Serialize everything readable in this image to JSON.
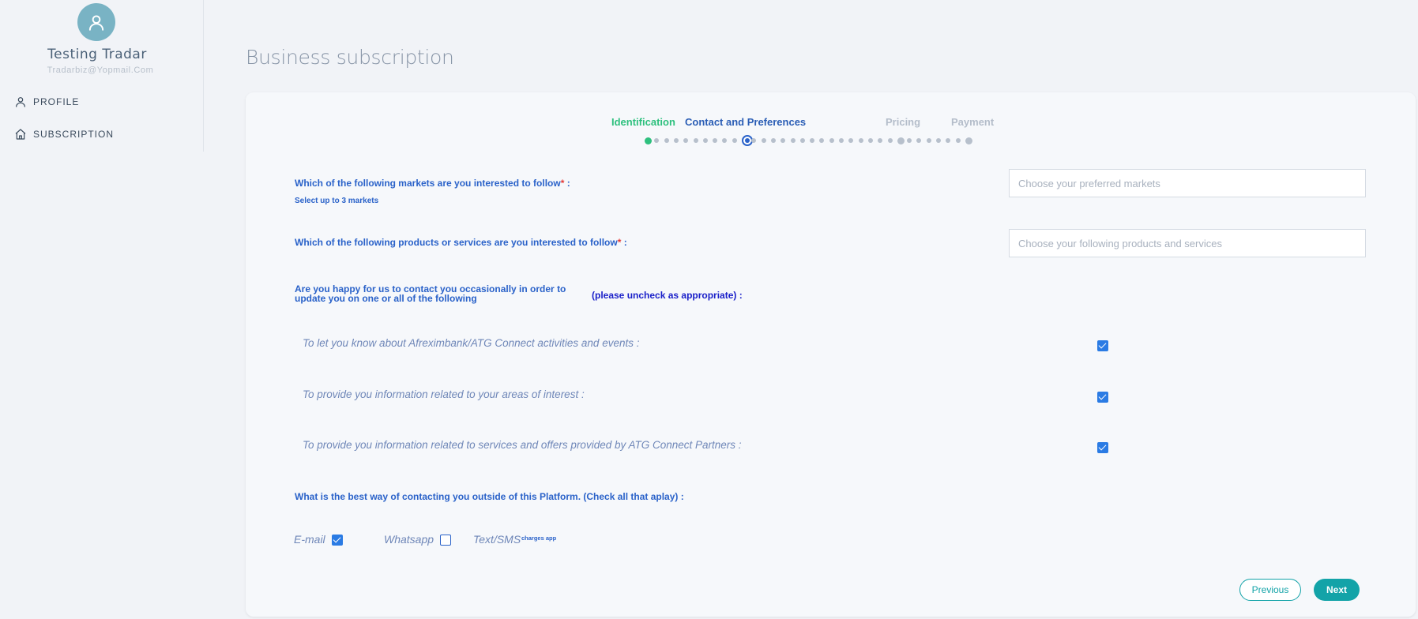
{
  "user": {
    "name": "Testing Tradar",
    "email": "Tradarbiz@Yopmail.Com"
  },
  "sidebar": {
    "items": [
      {
        "label": "PROFILE",
        "icon": "user-icon"
      },
      {
        "label": "SUBSCRIPTION",
        "icon": "home-icon"
      }
    ]
  },
  "page": {
    "title": "Business subscription"
  },
  "stepper": {
    "steps": [
      {
        "label": "Identification",
        "state": "done"
      },
      {
        "label": "Contact and Preferences",
        "state": "current"
      },
      {
        "label": "Pricing",
        "state": "upcoming"
      },
      {
        "label": "Payment",
        "state": "upcoming"
      }
    ]
  },
  "form": {
    "markets": {
      "question": "Which of the following markets are you interested to follow",
      "required_mark": "*",
      "suffix": " :",
      "hint": "Select up to 3 markets",
      "placeholder": "Choose your preferred markets"
    },
    "products": {
      "question": "Which of the following products or services are you interested to follow",
      "required_mark": "*",
      "suffix": " :",
      "placeholder": "Choose your following products and services"
    },
    "contact": {
      "question": "Are you happy for us to contact you occasionally in order to update you on one or all of the following",
      "note": "(please uncheck as appropriate) :",
      "options": [
        {
          "label": "To let you know about Afreximbank/ATG Connect activities and events :",
          "checked": true
        },
        {
          "label": "To provide you information related to your areas of interest :",
          "checked": true
        },
        {
          "label": "To provide you information related to services and offers provided by ATG Connect Partners :",
          "checked": true
        }
      ]
    },
    "channels": {
      "question": "What is the best way of contacting you outside of this Platform. (Check all that aplay) :",
      "options": [
        {
          "label": "E-mail",
          "checked": true
        },
        {
          "label": "Whatsapp",
          "checked": false
        },
        {
          "label": "Text/SMS",
          "checked": false,
          "note": "charges apply"
        }
      ]
    }
  },
  "buttons": {
    "previous": "Previous",
    "next": "Next"
  },
  "colors": {
    "accent": "#13a3a8",
    "primary_text": "#2a62c9",
    "success": "#2ec07e",
    "required": "#e53935"
  }
}
